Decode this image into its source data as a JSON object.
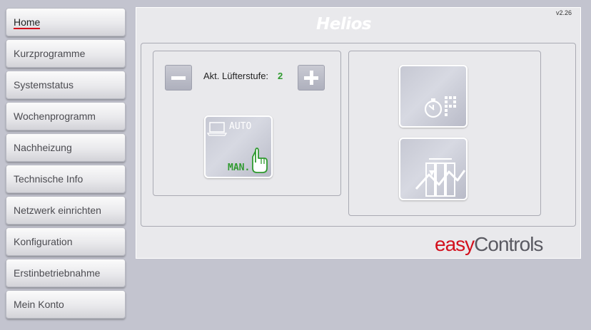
{
  "sidebar": {
    "items": [
      {
        "label": "Home",
        "active": true
      },
      {
        "label": "Kurzprogramme"
      },
      {
        "label": "Systemstatus"
      },
      {
        "label": "Wochenprogramm"
      },
      {
        "label": "Nachheizung"
      },
      {
        "label": "Technische Info"
      },
      {
        "label": "Netzwerk einrichten"
      },
      {
        "label": "Konfiguration"
      },
      {
        "label": "Erstinbetriebnahme"
      },
      {
        "label": "Mein Konto"
      }
    ]
  },
  "header": {
    "version": "v2.26",
    "brand": "Helios"
  },
  "fan_control": {
    "label": "Akt. Lüfterstufe:",
    "level": "2",
    "decrease_icon": "minus-icon",
    "increase_icon": "plus-icon"
  },
  "mode_tile": {
    "auto_text": "AUTO",
    "manual_text": "MAN.",
    "manual_active": true
  },
  "tiles": {
    "timer_party": "stopwatch-party-icon",
    "chart_mode": "chart-mode-icon"
  },
  "footer_logo": {
    "easy": "easy",
    "controls": "Controls"
  },
  "colors": {
    "background": "#c3c4cf",
    "accent_red": "#d3101d",
    "level_green": "#2f9a2f"
  }
}
